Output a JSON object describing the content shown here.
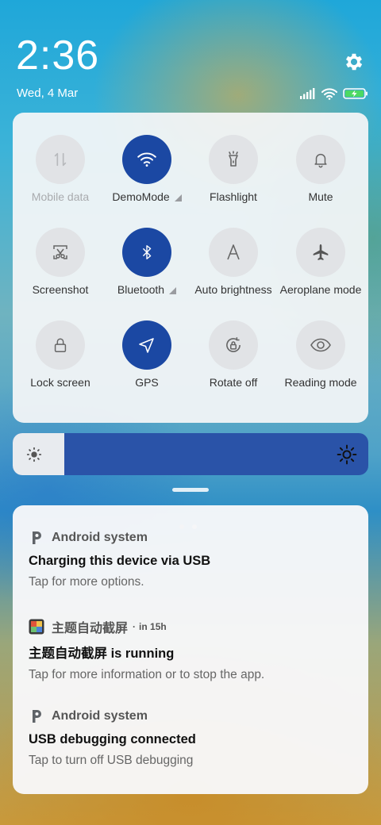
{
  "status": {
    "time": "2:36",
    "date": "Wed, 4 Mar",
    "icons": [
      "signal-icon",
      "wifi-icon",
      "battery-charging-icon"
    ]
  },
  "quick_settings": {
    "tiles": [
      {
        "label": "Mobile data",
        "icon": "mobile-data-icon",
        "active": false,
        "disabled": true,
        "has_menu": false
      },
      {
        "label": "DemoMode",
        "icon": "wifi-icon",
        "active": true,
        "disabled": false,
        "has_menu": true
      },
      {
        "label": "Flashlight",
        "icon": "flashlight-icon",
        "active": false,
        "disabled": false,
        "has_menu": false
      },
      {
        "label": "Mute",
        "icon": "bell-icon",
        "active": false,
        "disabled": false,
        "has_menu": false
      },
      {
        "label": "Screenshot",
        "icon": "screenshot-icon",
        "active": false,
        "disabled": false,
        "has_menu": false
      },
      {
        "label": "Bluetooth",
        "icon": "bluetooth-icon",
        "active": true,
        "disabled": false,
        "has_menu": true
      },
      {
        "label": "Auto brightness",
        "icon": "auto-brightness-icon",
        "active": false,
        "disabled": false,
        "has_menu": false
      },
      {
        "label": "Aeroplane mode",
        "icon": "airplane-icon",
        "active": false,
        "disabled": false,
        "has_menu": false
      },
      {
        "label": "Lock screen",
        "icon": "lock-icon",
        "active": false,
        "disabled": false,
        "has_menu": false
      },
      {
        "label": "GPS",
        "icon": "location-icon",
        "active": true,
        "disabled": false,
        "has_menu": false
      },
      {
        "label": "Rotate off",
        "icon": "rotate-lock-icon",
        "active": false,
        "disabled": false,
        "has_menu": false
      },
      {
        "label": "Reading mode",
        "icon": "eye-icon",
        "active": false,
        "disabled": false,
        "has_menu": false
      }
    ],
    "page_count": 2,
    "current_page": 1
  },
  "brightness": {
    "level": 0.145
  },
  "notifications": [
    {
      "app": "Android system",
      "time": "",
      "title": "Charging this device via USB",
      "body": "Tap for more options.",
      "icon": "android-system-icon"
    },
    {
      "app": "主题自动截屏",
      "time": "in 15h",
      "title": "主题自动截屏 is running",
      "body": "Tap for more information or to stop the app.",
      "icon": "app-thumbnail-icon"
    },
    {
      "app": "Android system",
      "time": "",
      "title": "USB debugging connected",
      "body": "Tap to turn off USB debugging",
      "icon": "android-system-icon"
    }
  ],
  "colors": {
    "tile_active": "#1b48a3",
    "tile_inactive": "#e1e3e6",
    "battery_charging": "#4cd964"
  }
}
